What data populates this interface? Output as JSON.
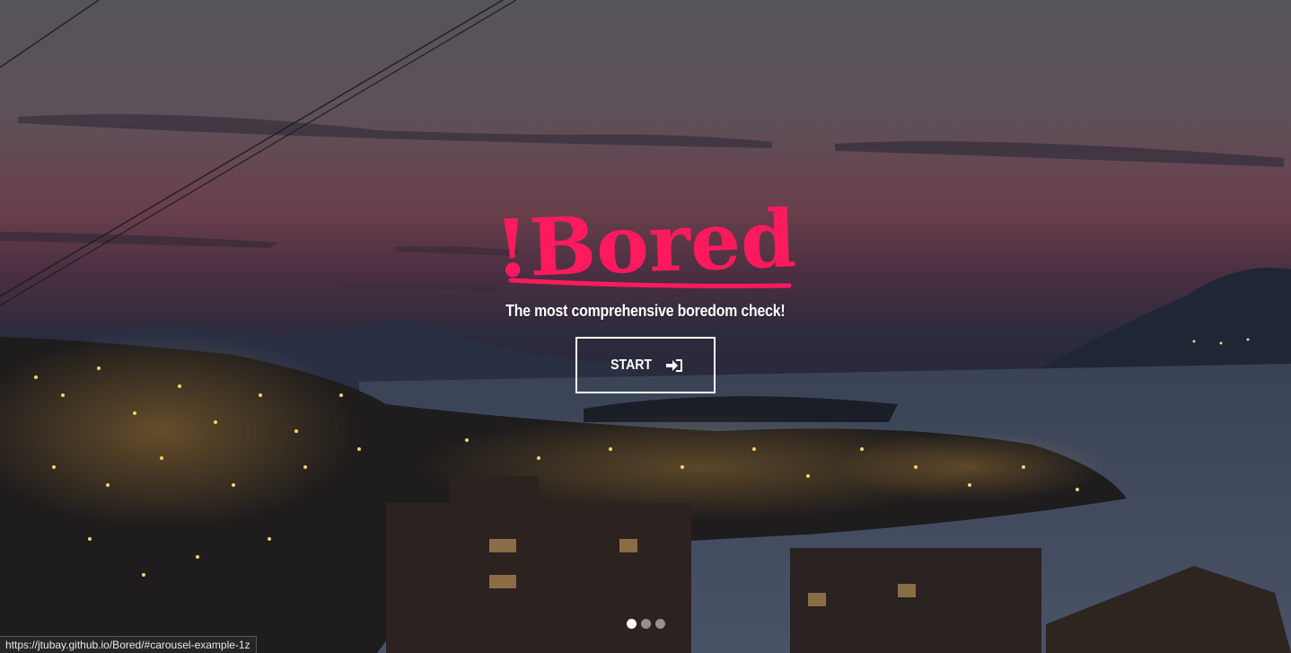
{
  "hero": {
    "logo_text": "!Bored",
    "tagline": "The most comprehensive boredom check!",
    "start_label": "START",
    "start_icon": "sign-in-icon"
  },
  "carousel": {
    "slide_count": 3,
    "active_index": 0
  },
  "status_bar": {
    "url": "https://jtubay.github.io/Bored/#carousel-example-1z"
  },
  "colors": {
    "logo": "#ff1a5e",
    "text": "#ffffff"
  }
}
